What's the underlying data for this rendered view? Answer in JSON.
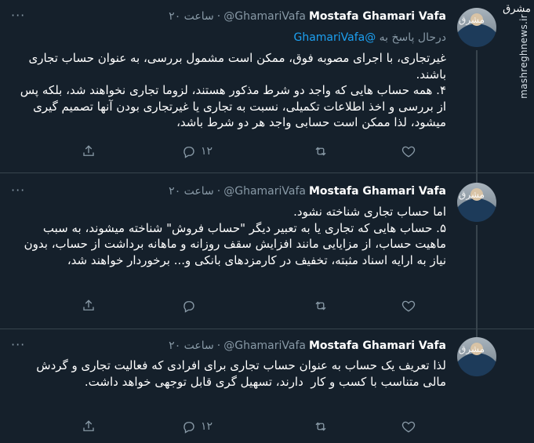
{
  "watermark": {
    "logo": "مشرق",
    "site": "mashreghnews.ir"
  },
  "tweets": [
    {
      "name": "Mostafa Ghamari Vafa",
      "handle": "@GhamariVafa",
      "time": "۲۰ ساعت",
      "more": "···",
      "reply_prefix": "درحال پاسخ به",
      "reply_mention": "@GhamariVafa",
      "text": "غیرتجاری، با اجرای مصوبه فوق، ممکن است مشمول بررسی، به عنوان حساب تجاری باشند.\n۴. همه حساب هایی که واجد دو شرط مذکور هستند، لزوما تجاری نخواهند شد، بلکه پس از بررسی و اخذ اطلاعات تکمیلی، نسبت به تجاری یا غیرتجاری بودن آنها تصمیم گیری میشود، لذا ممکن است حسابی واجد هر دو شرط باشد،",
      "retweets": "۱۲"
    },
    {
      "name": "Mostafa Ghamari Vafa",
      "handle": "@GhamariVafa",
      "time": "۲۰ ساعت",
      "more": "···",
      "text": "اما حساب تجاری شناخته نشود.\n۵. حساب هایی که تجاری یا به تعبیر دیگر \"حساب فروش\" شناخته میشوند، به سبب ماهیت حساب، از مزایایی مانند افزایش سقف روزانه و ماهانه برداشت از حساب، بدون نیاز به ارایه اسناد مثبته، تخفیف در کارمزدهای بانکی و... برخوردار خواهند شد،",
      "retweets": ""
    },
    {
      "name": "Mostafa Ghamari Vafa",
      "handle": "@GhamariVafa",
      "time": "۲۰ ساعت",
      "more": "···",
      "text": "لذا تعریف یک حساب به عنوان حساب تجاری برای افرادی که فعالیت تجاری و گردش مالی متناسب با کسب و کار  دارند، تسهیل گری قابل توجهی خواهد داشت.",
      "retweets": "۱۲"
    }
  ]
}
